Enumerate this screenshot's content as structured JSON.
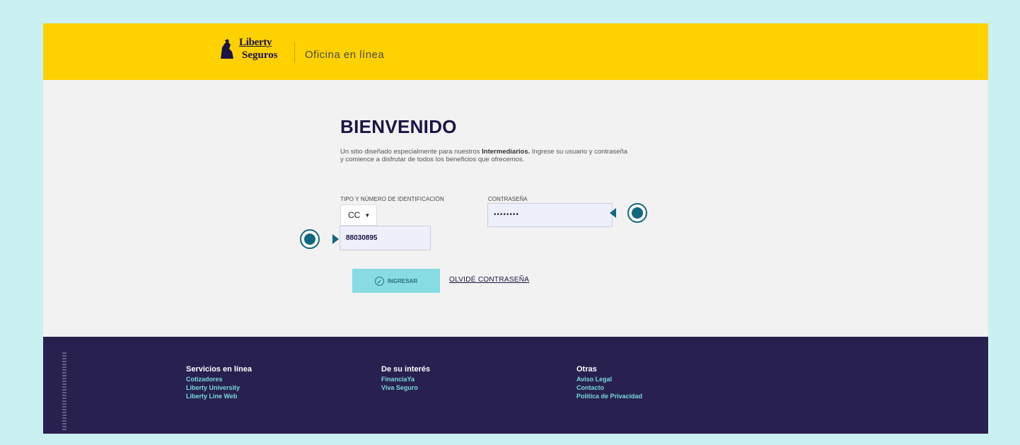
{
  "header": {
    "logo_line1": "Liberty",
    "logo_line2": "Seguros",
    "portal_name": "Oficina en línea"
  },
  "login": {
    "title": "BIENVENIDO",
    "intro_before": "Un sitio diseñado especialmente para nuestros ",
    "intro_bold": "Intermediarios.",
    "intro_after": " Ingrese su usuario y contraseña y comience a disfrutar de todos los beneficios que ofrecemos.",
    "id_label": "TIPO Y NÚMERO DE IDENTIFICACIÓN",
    "password_label": "CONTRASEÑA",
    "doc_type_value": "CC",
    "id_value": "88030895",
    "password_value": "••••••••",
    "login_button": "INGRESAR",
    "forgot_link": "OLVIDÉ CONTRASEÑA"
  },
  "footer": {
    "col1": {
      "title": "Servicios en línea",
      "links": [
        "Cotizadores",
        "Liberty University",
        "Liberty Line Web"
      ]
    },
    "col2": {
      "title": "De su interés",
      "links": [
        "FinanciaYa",
        "Viva Seguro"
      ]
    },
    "col3": {
      "title": "Otras",
      "links": [
        "Aviso Legal",
        "Contacto",
        "Política de Privacidad"
      ]
    }
  },
  "colors": {
    "header_bg": "#ffd100",
    "footer_bg": "#28214f",
    "button_bg": "#86dce2",
    "marker": "#11677c"
  },
  "icons": [
    "liberty-logo-icon",
    "check-circle-icon",
    "caret-down-icon",
    "callout-marker-icon"
  ]
}
